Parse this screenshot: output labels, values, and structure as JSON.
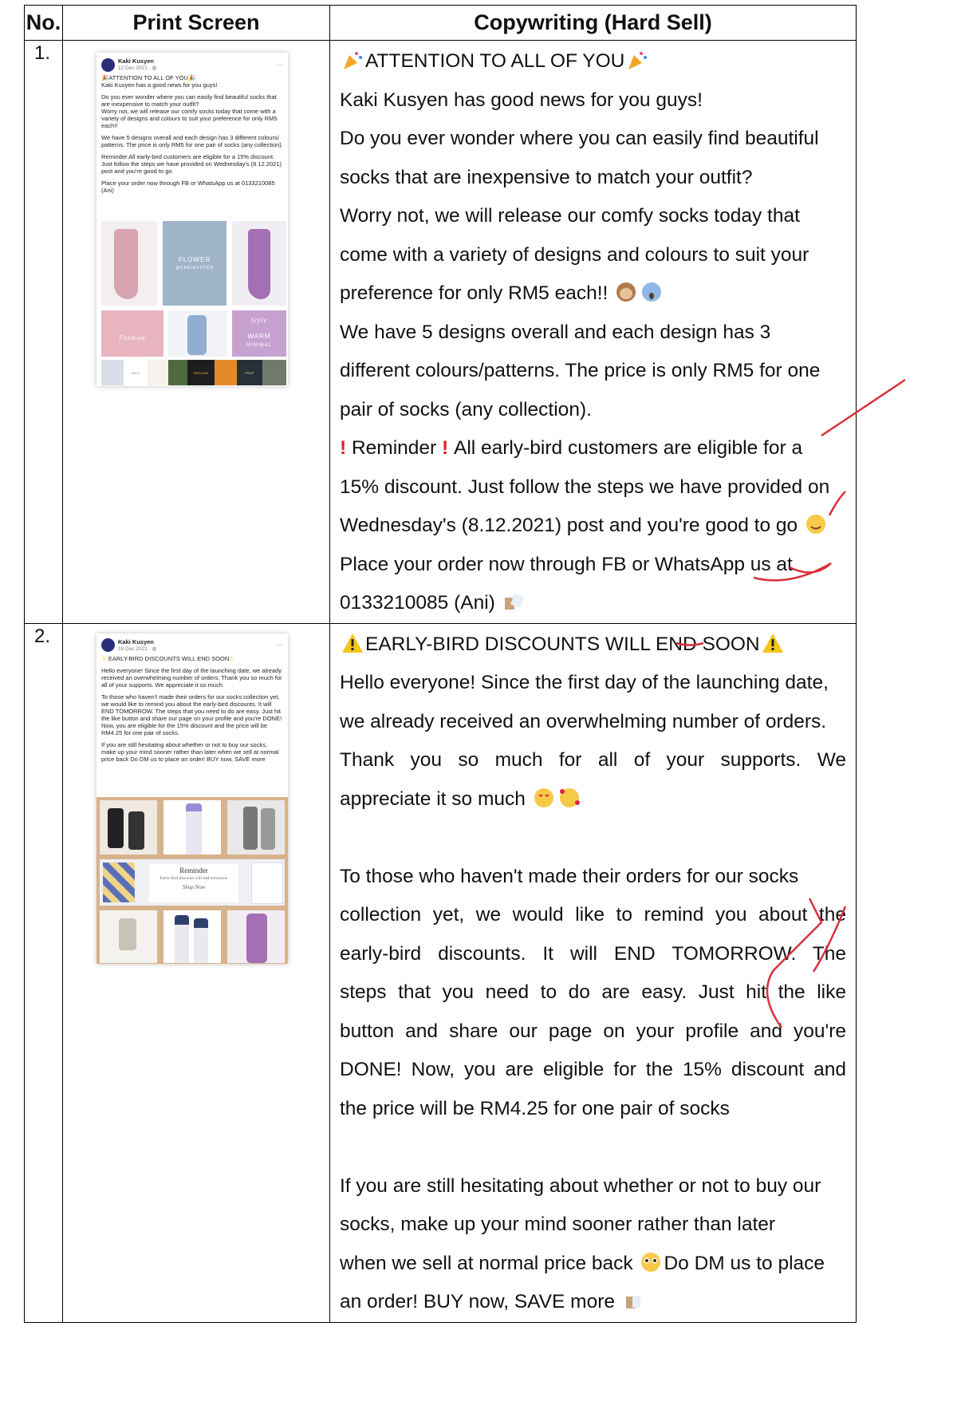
{
  "table": {
    "headers": [
      "No.",
      "Print Screen",
      "Copywriting (Hard Sell)"
    ]
  },
  "rows": [
    {
      "number": "1.",
      "post": {
        "page_name": "Kaki Kusyen",
        "date": "12 Dec 2021 · ",
        "paragraphs": [
          "ATTENTION TO ALL OF YOU",
          "Kaki Kusyen has a good news for you guys!",
          "Do you ever wonder where you can easily find beautiful socks that are inexpensive to match your outfit?\nWorry not, we will release our comfy socks today that come with a variety of designs and colours to suit your preference for only RM5 each!!",
          "We have 5 designs overall and each design has 3 different colours/ patterns. The price is only RM5 for one pair of socks (any collection).",
          "Reminder All early-bird customers are eligible for a 15% discount. Just follow the steps we have provided on Wednesday's (8.12.2021) post and you're good to go",
          "Place your order now through FB or WhatsApp us at 0133210085 (Ani)"
        ],
        "tile_captions": [
          "FLOWER",
          "@KAKIKUSYEN",
          "Fashion",
          "WARM",
          "MINIMAL",
          "Style",
          "NICE",
          "PREVIEW",
          "FRUIT"
        ]
      },
      "copy_lines": [
        "ATTENTION TO ALL OF YOU",
        "Kaki Kusyen has good news for you guys!",
        "Do you ever wonder where you can easily find beautiful",
        "socks that are inexpensive to match your outfit?",
        "Worry not, we will release our comfy socks today that",
        "come with a variety of designs and colours to suit your",
        "preference for only RM5 each!!",
        "We have 5 designs overall and each design has 3",
        "different colours/patterns. The price is only RM5 for one",
        "pair of socks (any collection).",
        "Reminder",
        "All early-bird customers are eligible for a",
        "15% discount. Just follow the steps we have provided on",
        "Wednesday's (8.12.2021) post and you're good to go",
        "Place your order now through FB or WhatsApp us at",
        "0133210085 (Ani)"
      ]
    },
    {
      "number": "2.",
      "post": {
        "page_name": "Kaki Kusyen",
        "date": "18 Dec 2021 · ",
        "paragraphs": [
          "EARLY-BIRD DISCOUNTS WILL END SOON",
          "Hello everyone! Since the first day of the launching date, we already received an overwhelming number of orders. Thank you so much for all of your supports. We appreciate it so much",
          "To those who haven't made their orders for our socks collection yet, we would like to remind you about the early-bird discounts. It will END TOMORROW. The steps that you need to do are easy. Just hit the like button and share our page on your profile and you're DONE! Now, you are eligible for the 15% discount and the price will be RM4.25 for one pair of socks.",
          "If you are still hesitating about whether or not to buy our socks, make up your mind sooner rather than later when we sell at normal price back Do DM us to place an order! BUY now, SAVE more"
        ],
        "reminder_title": "Reminder",
        "reminder_text": "Early-bird discount will end tomorrow",
        "reminder_cta": "Shop Now"
      },
      "copy_lines": [
        "EARLY-BIRD DISCOUNTS WILL END SOON",
        "Hello everyone! Since the first day of the launching date,",
        "we already received an overwhelming number of orders.",
        "Thank you so much for all of your supports. We",
        "appreciate it so much",
        "To those who haven't made their orders for our socks",
        "collection yet, we would like to remind you about the",
        "early-bird discounts. It will END TOMORROW. The",
        "steps that you need to do are easy. Just hit the like",
        "button and share our page on your profile and you're",
        "DONE! Now, you are eligible for the 15% discount and",
        "the price will be RM4.25 for one pair of socks",
        "If you are still hesitating about whether or not to buy our",
        "socks, make up your mind sooner rather than later",
        "when we sell at normal price back",
        "Do DM us to place",
        "an order! BUY now, SAVE more"
      ]
    }
  ],
  "colors": {
    "pen_annotation": "#d9303a",
    "warning_emoji": "#f5c518",
    "exclamation": "#e02020"
  }
}
